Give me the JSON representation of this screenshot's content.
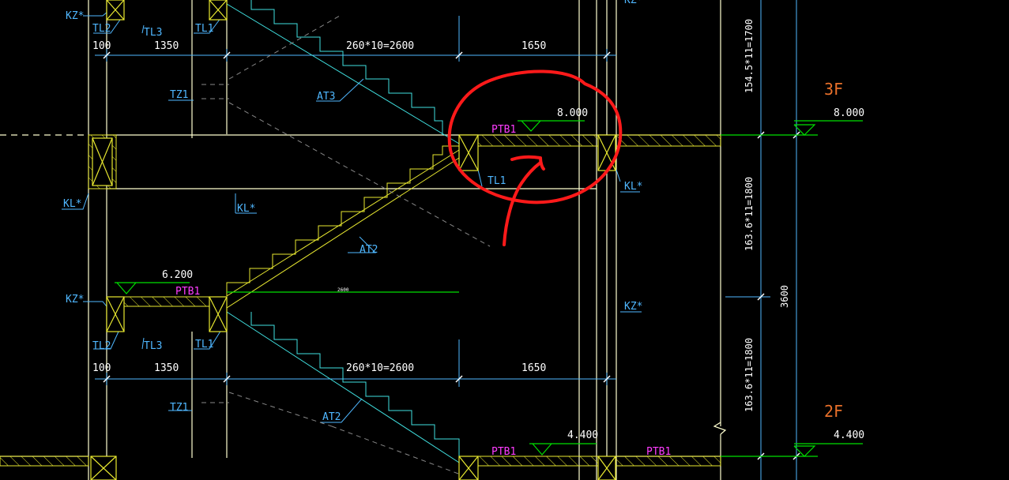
{
  "labels": {
    "kz_top_left": "KZ*",
    "kz_top_right": "KZ*",
    "tl2_top": "TL2",
    "tl3_top": "TL3",
    "tl1_top": "TL1",
    "dim100_top": "100",
    "dim1350_top": "1350",
    "dim_flight_top": "260*10=2600",
    "dim1650_top": "1650",
    "tz1_top": "TZ1",
    "at3": "AT3",
    "ptb1_upper": "PTB1",
    "elev_8000_landing": "8.000",
    "tl1_landing_upper": "TL1",
    "kl_left": "KL*",
    "kl_mid": "KL*",
    "kl_right": "KL*",
    "at2_upper": "AT2",
    "elev_6200": "6.200",
    "ptb1_mid": "PTB1",
    "dim2600_small": "2600",
    "kz_mid_left": "KZ*",
    "kz_mid_right": "KZ*",
    "tl2_bottom": "TL2",
    "tl3_bottom": "TL3",
    "tl1_bottom": "TL1",
    "dim100_bottom": "100",
    "dim1350_bottom": "1350",
    "dim_flight_bottom": "260*10=2600",
    "dim1650_bottom": "1650",
    "tz1_bottom": "TZ1",
    "at2_lower": "AT2",
    "ptb1_lower_a": "PTB1",
    "ptb1_lower_b": "PTB1",
    "elev_4400_landing": "4.400",
    "riser_top": "154.5*11=1700",
    "riser_mid": "163.6*11=1800",
    "riser_bottom": "163.6*11=1800",
    "storey_height": "3600",
    "floor_3f": "3F",
    "floor_3f_elev": "8.000",
    "floor_2f": "2F",
    "floor_2f_elev": "4.400"
  },
  "colors": {
    "background": "#000000",
    "wall_line": "#ffffd0",
    "dimension": "#4fb7ff",
    "stair": "#40e0e0",
    "structure_yellow": "#e8e830",
    "green": "#00e000",
    "annotation_magenta": "#ff3cff",
    "floor_label": "#e8702a",
    "highlight_circle": "#ff1a1a"
  },
  "annotations": {
    "highlight": "red-hand-drawn-circle-with-arrow"
  }
}
